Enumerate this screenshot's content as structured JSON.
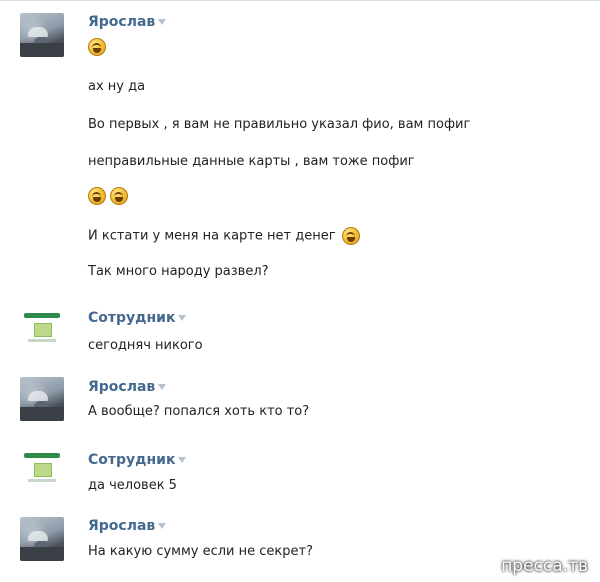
{
  "sender_user": "Ярослав",
  "sender_bank": "Сотрудник",
  "messages": [
    {
      "lines": [
        "",
        "ах ну да",
        "Во первых , я вам не правильно указал фио, вам пофиг",
        "неправильные данные карты , вам тоже пофиг",
        "",
        "И кстати у меня на карте нет денег",
        "Так много народу развел?"
      ]
    },
    {
      "lines": [
        "сегодняч никого"
      ]
    },
    {
      "lines": [
        "А вообще? попался хоть кто то?"
      ]
    },
    {
      "lines": [
        "да человек 5"
      ]
    },
    {
      "lines": [
        "На какую сумму если не секрет?"
      ]
    }
  ],
  "watermark": "пресса.тв",
  "icons": {
    "emoji": "laughing-face-icon",
    "menu": "chevron-down-icon"
  }
}
